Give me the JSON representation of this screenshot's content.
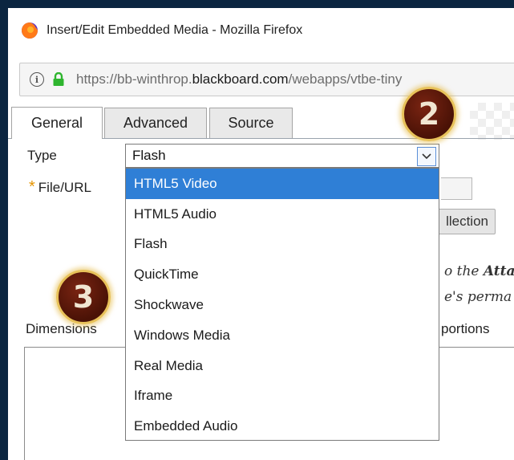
{
  "window": {
    "title": "Insert/Edit Embedded Media - Mozilla Firefox",
    "url_prefix": "https://bb-winthrop.",
    "url_domain": "blackboard.com",
    "url_suffix": "/webapps/vtbe-tiny"
  },
  "tabs": [
    {
      "label": "General",
      "active": true
    },
    {
      "label": "Advanced",
      "active": false
    },
    {
      "label": "Source",
      "active": false
    }
  ],
  "form": {
    "type_label": "Type",
    "type_value": "Flash",
    "file_label": "File/URL",
    "required_marker": "*",
    "collection_button": "llection",
    "note_line1_a": "o the ",
    "note_line1_b": "Atta",
    "note_line2": "e's perma",
    "dimensions_label": "Dimensions",
    "proportions_label": "portions"
  },
  "dropdown": {
    "options": [
      "HTML5 Video",
      "HTML5 Audio",
      "Flash",
      "QuickTime",
      "Shockwave",
      "Windows Media",
      "Real Media",
      "Iframe",
      "Embedded Audio"
    ],
    "highlighted_index": 0
  },
  "badges": {
    "badge_2": "2",
    "badge_3": "3"
  },
  "colors": {
    "highlight": "#2f7fd6",
    "required_star": "#e59400",
    "badge_fill": "#5a1808",
    "badge_ring": "#e8c25a",
    "lock_green": "#2fb52f"
  }
}
